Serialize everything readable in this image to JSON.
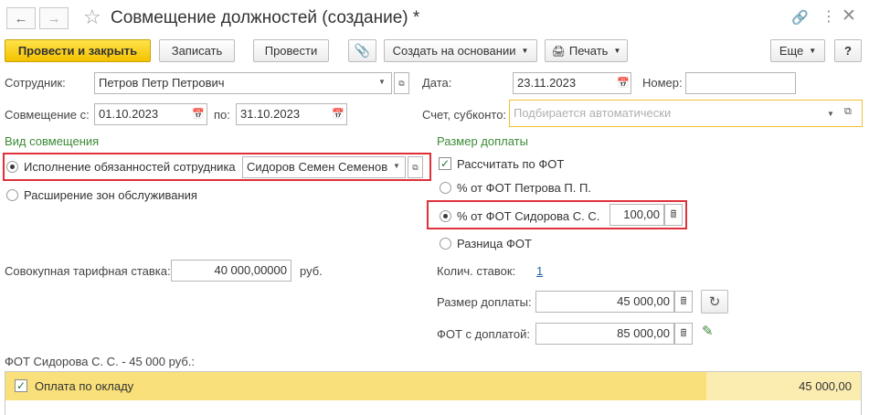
{
  "header": {
    "title": "Совмещение должностей (создание) *"
  },
  "toolbar": {
    "post_close": "Провести и закрыть",
    "save": "Записать",
    "post": "Провести",
    "create_basis": "Создать на основании",
    "print": "Печать",
    "more": "Еще",
    "help": "?"
  },
  "form": {
    "employee_label": "Сотрудник:",
    "employee_value": "Петров Петр Петрович",
    "date_label": "Дата:",
    "date_value": "23.11.2023",
    "number_label": "Номер:",
    "number_value": "",
    "combine_from_label": "Совмещение с:",
    "combine_from_value": "01.10.2023",
    "combine_to_label": "по:",
    "combine_to_value": "31.10.2023",
    "account_label": "Счет, субконто:",
    "account_placeholder": "Подбирается автоматически"
  },
  "combination": {
    "section_title": "Вид совмещения",
    "option1_label": "Исполнение обязанностей сотрудника",
    "option1_employee": "Сидоров Семен Семенов",
    "option2_label": "Расширение зон обслуживания",
    "rate_label": "Совокупная тарифная ставка:",
    "rate_value": "40 000,00000",
    "rate_unit": "руб."
  },
  "surcharge": {
    "section_title": "Размер доплаты",
    "calc_checkbox_label": "Рассчитать по ФОТ",
    "opt_petrov": "% от ФОТ Петрова П. П.",
    "opt_sidorov": "% от ФОТ Сидорова С. С.",
    "percent_value": "100,00",
    "opt_diff": "Разница ФОТ",
    "rates_count_label": "Колич. ставок:",
    "rates_count_value": "1",
    "amount_label": "Размер доплаты:",
    "amount_value": "45 000,00",
    "fot_label": "ФОТ с доплатой:",
    "fot_value": "85 000,00"
  },
  "table": {
    "caption": "ФОТ Сидорова С. С. - 45 000 руб.:",
    "rows": [
      {
        "name": "Оплата по окладу",
        "amount": "45 000,00"
      }
    ]
  },
  "colors": {
    "accent_yellow": "#f4c200",
    "highlight_red": "#e0303a",
    "section_green": "#3c8a36"
  }
}
